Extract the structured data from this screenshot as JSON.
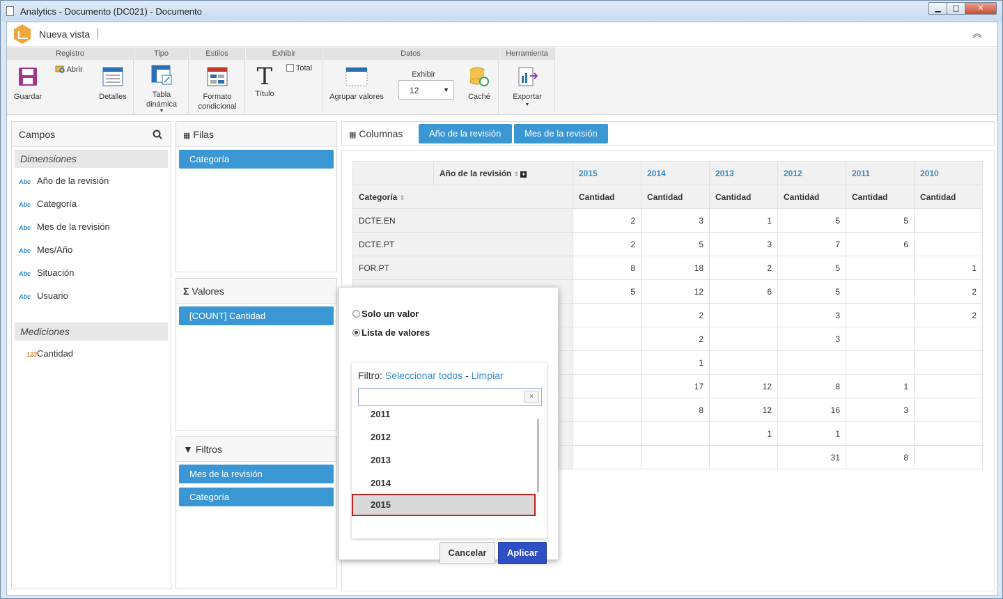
{
  "window": {
    "title": "Analytics - Documento (DC021) - Documento",
    "buttons": {
      "minimize": "▁",
      "maximize": "□",
      "close": "✕"
    }
  },
  "app": {
    "title": "Nueva vista",
    "collapse": "︽"
  },
  "ribbon": {
    "groups": {
      "registro": "Registro",
      "tipo": "Tipo",
      "estilos": "Estilos",
      "exhibir": "Exhibir",
      "datos": "Datos",
      "herramienta": "Herramienta"
    },
    "guardar": "Guardar",
    "abrir": "Abrir",
    "detalles": "Detalles",
    "tabla_dinamica": "Tabla dinámica",
    "formato_condicional": "Formato condicional",
    "titulo": "Título",
    "total": "Total",
    "agrupar_valores": "Agrupar valores",
    "exhibir_label": "Exhibir",
    "exhibir_value": "12",
    "cache": "Caché",
    "exportar": "Exportar"
  },
  "campos": {
    "title": "Campos",
    "dimensiones_title": "Dimensiones",
    "dim_tag": "Abc",
    "dimensiones": [
      "Año de la revisión",
      "Categoría",
      "Mes de la revisión",
      "Mes/Año",
      "Situación",
      "Usuario"
    ],
    "mediciones_title": "Mediciones",
    "med_tag": "123",
    "mediciones": [
      "Cantidad"
    ]
  },
  "filas": {
    "title": "Filas",
    "chips": [
      "Categoría"
    ]
  },
  "valores": {
    "title": "Valores",
    "chips": [
      "[COUNT] Cantidad"
    ]
  },
  "filtros": {
    "title": "Filtros",
    "chips": [
      "Mes de la revisión",
      "Categoría"
    ]
  },
  "columnas": {
    "title": "Columnas",
    "chips": [
      "Año de la revisión",
      "Mes de la revisión"
    ]
  },
  "pivot": {
    "col_header": "Año de la revisión",
    "row_header": "Categoría",
    "years": [
      "2015",
      "2014",
      "2013",
      "2012",
      "2011",
      "2010"
    ],
    "measure": "Cantidad",
    "rows": [
      {
        "cat": "DCTE.EN",
        "vals": [
          "2",
          "3",
          "1",
          "5",
          "5",
          ""
        ]
      },
      {
        "cat": "DCTE.PT",
        "vals": [
          "2",
          "5",
          "3",
          "7",
          "6",
          ""
        ]
      },
      {
        "cat": "FOR.PT",
        "vals": [
          "8",
          "18",
          "2",
          "5",
          "",
          "1"
        ]
      },
      {
        "cat": "",
        "vals": [
          "5",
          "12",
          "6",
          "5",
          "",
          "2"
        ]
      },
      {
        "cat": "",
        "vals": [
          "",
          "2",
          "",
          "3",
          "",
          "2"
        ]
      },
      {
        "cat": "",
        "vals": [
          "",
          "2",
          "",
          "3",
          "",
          ""
        ]
      },
      {
        "cat": "",
        "vals": [
          "",
          "1",
          "",
          "",
          "",
          ""
        ]
      },
      {
        "cat": "",
        "vals": [
          "",
          "17",
          "12",
          "8",
          "1",
          ""
        ]
      },
      {
        "cat": "",
        "vals": [
          "",
          "8",
          "12",
          "16",
          "3",
          ""
        ]
      },
      {
        "cat": "",
        "vals": [
          "",
          "",
          "1",
          "1",
          "",
          ""
        ]
      },
      {
        "cat": "",
        "vals": [
          "",
          "",
          "",
          "31",
          "8",
          ""
        ]
      }
    ]
  },
  "popup": {
    "solo_un_valor": "Solo un valor",
    "lista_de_valores": "Lista de valores",
    "filtro_label": "Filtro:",
    "seleccionar_todos": "Seleccionar todos",
    "separator": "-",
    "limpiar": "Limpiar",
    "clear": "×",
    "search_value": "",
    "options": [
      "2011",
      "2012",
      "2013",
      "2014",
      "2015"
    ],
    "selected": "2015",
    "cancelar": "Cancelar",
    "aplicar": "Aplicar"
  }
}
